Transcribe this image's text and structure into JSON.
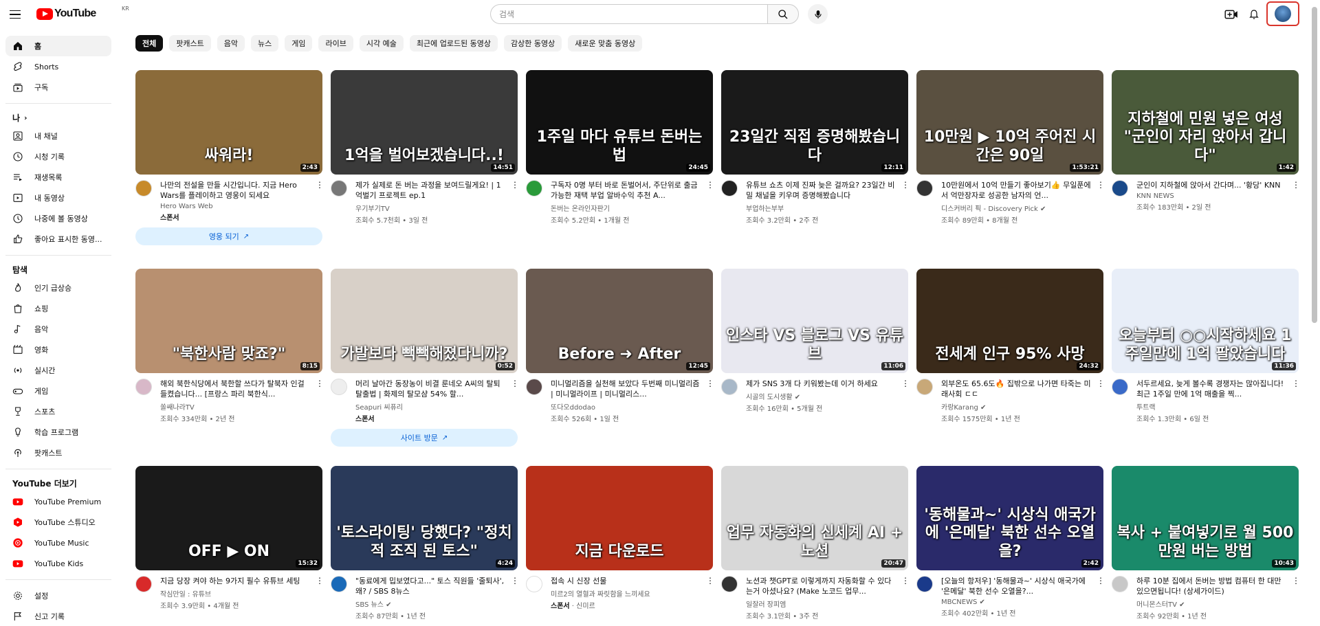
{
  "header": {
    "logo_text": "YouTube",
    "logo_country": "KR",
    "search_placeholder": "검색",
    "icons": [
      "menu-icon",
      "search-icon",
      "mic-icon",
      "create-icon",
      "bell-icon",
      "avatar"
    ]
  },
  "sidebar": {
    "main": [
      {
        "icon": "home-icon",
        "label": "홈",
        "active": true
      },
      {
        "icon": "shorts-icon",
        "label": "Shorts"
      },
      {
        "icon": "subscriptions-icon",
        "label": "구독"
      }
    ],
    "you_heading": "나",
    "you": [
      {
        "icon": "channel-icon",
        "label": "내 채널"
      },
      {
        "icon": "history-icon",
        "label": "시청 기록"
      },
      {
        "icon": "playlist-icon",
        "label": "재생목록"
      },
      {
        "icon": "my-videos-icon",
        "label": "내 동영상"
      },
      {
        "icon": "watch-later-icon",
        "label": "나중에 볼 동영상"
      },
      {
        "icon": "liked-icon",
        "label": "좋아요 표시한 동영..."
      }
    ],
    "explore_heading": "탐색",
    "explore": [
      {
        "icon": "trending-icon",
        "label": "인기 급상승"
      },
      {
        "icon": "shopping-icon",
        "label": "쇼핑"
      },
      {
        "icon": "music-icon",
        "label": "음악"
      },
      {
        "icon": "movie-icon",
        "label": "영화"
      },
      {
        "icon": "live-icon",
        "label": "실시간"
      },
      {
        "icon": "gaming-icon",
        "label": "게임"
      },
      {
        "icon": "sports-icon",
        "label": "스포츠"
      },
      {
        "icon": "learning-icon",
        "label": "학습 프로그램"
      },
      {
        "icon": "podcast-icon",
        "label": "팟캐스트"
      }
    ],
    "more_heading": "YouTube 더보기",
    "more": [
      {
        "icon": "yt-premium-icon",
        "label": "YouTube Premium"
      },
      {
        "icon": "yt-studio-icon",
        "label": "YouTube 스튜디오"
      },
      {
        "icon": "yt-music-icon",
        "label": "YouTube Music"
      },
      {
        "icon": "yt-kids-icon",
        "label": "YouTube Kids"
      }
    ],
    "bottom": [
      {
        "icon": "settings-icon",
        "label": "설정"
      },
      {
        "icon": "report-history-icon",
        "label": "신고 기록"
      }
    ]
  },
  "chips": [
    "전체",
    "팟캐스트",
    "음악",
    "뉴스",
    "게임",
    "라이브",
    "시각 예술",
    "최근에 업로드된 동영상",
    "감상한 동영상",
    "새로운 맞춤 동영상"
  ],
  "videos": [
    {
      "title": "나만의 전설을 만들 시간입니다. 지금 Hero Wars를 플레이하고 영웅이 되세요",
      "channel": "Hero Wars Web",
      "stats": "",
      "duration": "2:43",
      "thumb_text": "싸워라!",
      "thumb_bg": "#8b6b3a",
      "avatar": "#c78a2a",
      "ad": true,
      "ad_label": "스폰서",
      "ad_button": "영웅 되기"
    },
    {
      "title": "제가 실제로 돈 버는 과정을 보여드릴게요! | 1억벌기 프로젝트 ep.1",
      "channel": "우기부기TV",
      "stats": "조회수 5.7천회 • 3일 전",
      "duration": "14:51",
      "thumb_text": "1억을 벌어보겠습니다..!",
      "thumb_bg": "#3a3a3a",
      "avatar": "#777"
    },
    {
      "title": "구독자 0명 부터 바로 돈벌어서, 주단위로 출금 가능한 재택 부업 알바수익 추천 A...",
      "channel": "돈버는 온라인자판기",
      "stats": "조회수 5.2만회 • 1개월 전",
      "duration": "24:45",
      "thumb_text": "1주일 마다 유튜브 돈버는법",
      "thumb_bg": "#111",
      "avatar": "#2a9a3a"
    },
    {
      "title": "유튜브 쇼츠 이제 진짜 늦은 걸까요? 23일간 비밀 채널을 키우며 증명해봤습니다",
      "channel": "부업하는부부",
      "stats": "조회수 3.2만회 • 2주 전",
      "duration": "12:11",
      "thumb_text": "23일간 직접 증명해봤습니다",
      "thumb_bg": "#1a1a1a",
      "avatar": "#222"
    },
    {
      "title": "10만원에서 10억 만들기 좋아보기👍 무일푼에서 억만장자로 성공한 남자의 언...",
      "channel": "디스커버리 픽 - Discovery Pick ✔",
      "stats": "조회수 89만회 • 8개월 전",
      "duration": "1:53:21",
      "thumb_text": "10만원 ▶ 10억 주어진 시간은 90일",
      "thumb_bg": "#5a5040",
      "avatar": "#333"
    },
    {
      "title": "군인이 지하철에 앉아서 간다며... '황당' KNN",
      "channel": "KNN NEWS",
      "stats": "조회수 183만회 • 2일 전",
      "duration": "1:42",
      "thumb_text": "지하철에 민원 넣은 여성 \"군인이 자리 앉아서 갑니다\"",
      "thumb_bg": "#4a5a3a",
      "avatar": "#1a4a8a"
    },
    {
      "title": "해외 북한식당에서 북한할 쓰다가 탈북자 인걸 들켰습니다... [프랑스 파리 북한식...",
      "channel": "쏠쌔나라TV",
      "stats": "조회수 334만회 • 2년 전",
      "duration": "8:15",
      "thumb_text": "\"북한사람 맞죠?\"",
      "thumb_bg": "#b89070",
      "avatar": "#d8b8c8"
    },
    {
      "title": "머리 날아간 동장농이 비결 룬네오 A씨의 탈퇴 탈출법 | 화제의 탈모샴 54% 할...",
      "channel": "Seapuri 씨퓨리",
      "stats": "",
      "duration": "0:52",
      "thumb_text": "가발보다 빽빽해졌다니까?",
      "thumb_bg": "#d8d0c8",
      "avatar": "#eee",
      "ad": true,
      "ad_label": "스폰서",
      "ad_button": "사이트 방문"
    },
    {
      "title": "미니멀리즘을 실천해 보았다 두번째 미니멀리즘 | 미니멀라이프 | 미니멀리스...",
      "channel": "또다오ddodao",
      "stats": "조회수 526회 • 1일 전",
      "duration": "12:45",
      "thumb_text": "Before ➜ After",
      "thumb_bg": "#6a5a50",
      "avatar": "#5a4a4a"
    },
    {
      "title": "제가 SNS 3개 다 키워봤는데 이거 하세요",
      "channel": "시골의 도시생활 ✔",
      "stats": "조회수 16만회 • 5개월 전",
      "duration": "11:06",
      "thumb_text": "인스타 VS 블로그 VS 유튜브",
      "thumb_bg": "#e8e8f0",
      "avatar": "#a8b8c8"
    },
    {
      "title": "외부온도 65.6도🔥 집밖으로 나가면 타죽는 미래사회 ㄷㄷ",
      "channel": "카랑Karang ✔",
      "stats": "조회수 1575만회 • 1년 전",
      "duration": "24:32",
      "thumb_text": "전세계 인구 95% 사망",
      "thumb_bg": "#3a2a1a",
      "avatar": "#c8a878"
    },
    {
      "title": "서두르세요, 늦게 볼수록 경쟁자는 많아집니다! 최근 1주일 만에 1억 매출을 찍...",
      "channel": "투트랙",
      "stats": "조회수 1.3만회 • 6일 전",
      "duration": "11:36",
      "thumb_text": "오늘부터 ○○시작하세요 1주일만에 1억 팔았습니다",
      "thumb_bg": "#e8eef8",
      "avatar": "#3a6ac8"
    },
    {
      "title": "지금 당장 켜야 하는 9가지 필수 유튜브 세팅",
      "channel": "작심만일 : 유튜브",
      "stats": "조회수 3.9만회 • 4개월 전",
      "duration": "15:32",
      "thumb_text": "OFF  ▶  ON",
      "thumb_bg": "#1a1a1a",
      "avatar": "#d82a2a"
    },
    {
      "title": "\"동료에게 밉보였다고...\" 토스 직원들 '줄퇴사', 왜? / SBS 8뉴스",
      "channel": "SBS 뉴스 ✔",
      "stats": "조회수 87만회 • 1년 전",
      "duration": "4:24",
      "thumb_text": "'토스라이팅' 당했다? \"정치적 조직 된 토스\"",
      "thumb_bg": "#2a3a5a",
      "avatar": "#1a6ab8"
    },
    {
      "title": "접속 시 신장 선물",
      "channel": "미르2의 열혈과 짜릿함을 느끼세요",
      "stats": "",
      "duration": "",
      "thumb_text": "지금 다운로드",
      "thumb_bg": "#b8301a",
      "avatar": "#fff",
      "ad": true,
      "ad_label": "스폰서",
      "ad_channel": "신미르"
    },
    {
      "title": "노션과 챗GPT로 이렇게까지 자동화할 수 있다는거 아셨나요? (Make 노코드 업무...",
      "channel": "일잘러 장피엠",
      "stats": "조회수 3.1만회 • 3주 전",
      "duration": "20:47",
      "thumb_text": "업무 자동화의 신세계 AI + 노션",
      "thumb_bg": "#d8d8d8",
      "avatar": "#333"
    },
    {
      "title": "[오늘의 항저우] '동해물과~' 시상식 애국가에 '은메달' 북한 선수 오열을?...",
      "channel": "MBCNEWS ✔",
      "stats": "조회수 402만회 • 1년 전",
      "duration": "2:42",
      "thumb_text": "'동해물과~' 시상식 애국가에 '은메달' 북한 선수 오열을?",
      "thumb_bg": "#2a2a6a",
      "avatar": "#1a3a8a"
    },
    {
      "title": "하루 10분 집에서 돈버는 방법 컴퓨터 한 대만 있으면됩니다! (상세가이드)",
      "channel": "머니몬스터TV ✔",
      "stats": "조회수 92만회 • 1년 전",
      "duration": "10:43",
      "thumb_text": "복사 + 붙여넣기로 월 500만원 버는 방법",
      "thumb_bg": "#1a8a6a",
      "avatar": "#c8c8c8"
    }
  ]
}
